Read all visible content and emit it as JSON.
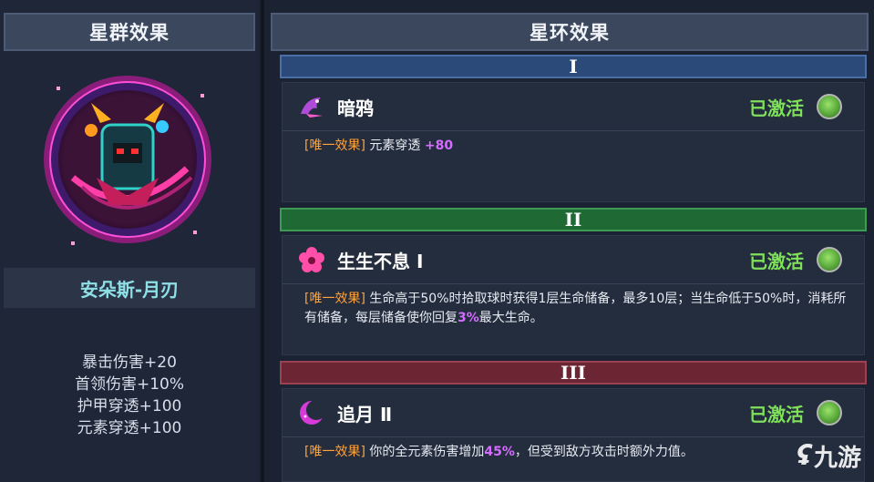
{
  "left_panel": {
    "title": "星群效果",
    "hero_name": "安朵斯-月刃",
    "stats": [
      "暴击伤害+20",
      "首领伤害+10%",
      "护甲穿透+100",
      "元素穿透+100"
    ]
  },
  "right_panel": {
    "title": "星环效果",
    "tiers": [
      {
        "numeral": "I",
        "color": "#2b4a7a",
        "effect": {
          "icon": "crow-icon",
          "name": "暗鸦",
          "status": "已激活",
          "tag": "[唯一效果]",
          "text_before": " 元素穿透 ",
          "highlight": "+80",
          "text_after": ""
        }
      },
      {
        "numeral": "II",
        "color": "#1f6a34",
        "effect": {
          "icon": "flower-icon",
          "name": "生生不息 Ⅰ",
          "status": "已激活",
          "tag": "[唯一效果]",
          "text_before": " 生命高于50%时拾取球时获得1层生命储备，最多10层；当生命低于50%时，消耗所有储备，每层储备使你回复",
          "highlight": "3%",
          "text_after": "最大生命。"
        }
      },
      {
        "numeral": "III",
        "color": "#6c2633",
        "effect": {
          "icon": "crescent-moon-icon",
          "name": "追月 Ⅱ",
          "status": "已激活",
          "tag": "[唯一效果]",
          "text_before": " 你的全元素伤害增加",
          "highlight": "45%",
          "text_after": "，但受到敌方攻击时额外力值。"
        }
      }
    ]
  },
  "watermark": {
    "text": "九游"
  },
  "colors": {
    "status_green": "#7fe05a",
    "tag_orange": "#ffa33a",
    "highlight_purple": "#d46cff",
    "hero_name_cyan": "#8fe0e6"
  }
}
